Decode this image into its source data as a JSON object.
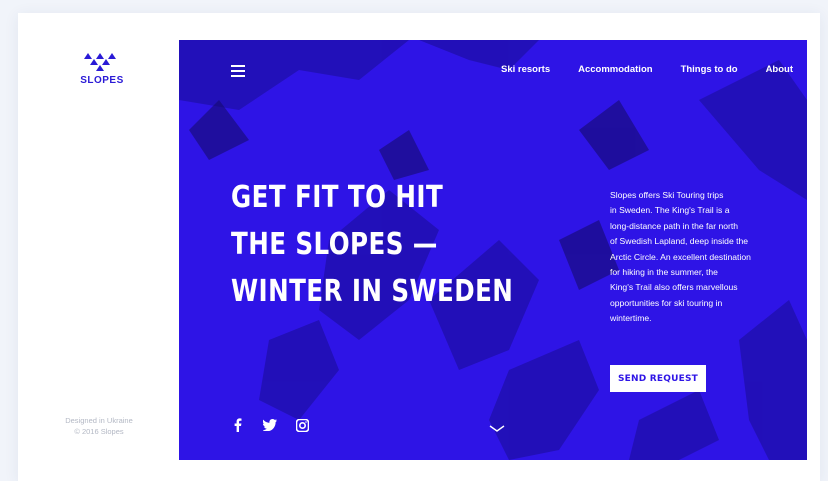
{
  "brand": {
    "name": "SLOPES",
    "logo_icon": "mountain-logo-icon",
    "color": "#2a1ad6"
  },
  "footer": {
    "designed": "Designed in Ukraine",
    "copyright": "© 2016 Slopes"
  },
  "nav": {
    "menu_icon": "hamburger-icon",
    "items": [
      {
        "label": "Ski resorts"
      },
      {
        "label": "Accommodation"
      },
      {
        "label": "Things to do"
      },
      {
        "label": "About"
      }
    ]
  },
  "hero": {
    "background_color": "#2e14e6",
    "headline": [
      "GET FIT TO HIT",
      "THE SLOPES —",
      "WINTER IN SWEDEN"
    ],
    "intro_lines": [
      "Slopes offers Ski Touring trips",
      "in Sweden. The King's Trail is a",
      "long-distance path in the far north",
      "of Swedish Lapland, deep inside the",
      "Arctic Circle. An excellent destination",
      "for hiking in the summer, the",
      "King's Trail also offers marvellous",
      "opportunities for ski touring in",
      "wintertime."
    ],
    "cta_label": "SEND REQUEST"
  },
  "socials": [
    {
      "icon": "facebook-icon"
    },
    {
      "icon": "twitter-icon"
    },
    {
      "icon": "instagram-icon"
    }
  ],
  "scroll_icon": "chevron-down-icon"
}
